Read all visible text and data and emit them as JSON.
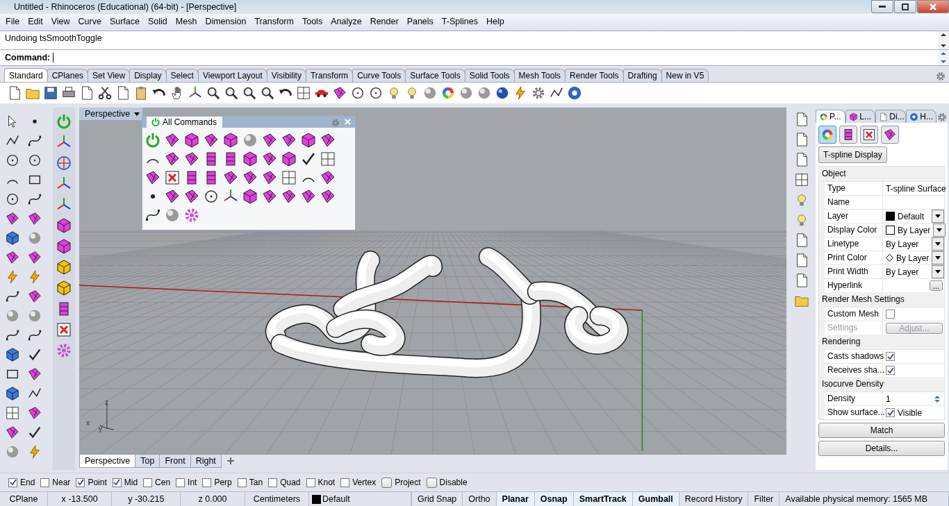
{
  "window": {
    "title": "Untitled - Rhinoceros (Educational) (64-bit) - [Perspective]"
  },
  "menu": [
    "File",
    "Edit",
    "View",
    "Curve",
    "Surface",
    "Solid",
    "Mesh",
    "Dimension",
    "Transform",
    "Tools",
    "Analyze",
    "Render",
    "Panels",
    "T-Splines",
    "Help"
  ],
  "command": {
    "history": "Undoing tsSmoothToggle",
    "prompt": "Command:"
  },
  "toolbar_tabs": [
    {
      "label": "Standard",
      "selected": true
    },
    {
      "label": "CPlanes",
      "selected": false
    },
    {
      "label": "Set View",
      "selected": false
    },
    {
      "label": "Display",
      "selected": false
    },
    {
      "label": "Select",
      "selected": false
    },
    {
      "label": "Viewport Layout",
      "selected": false
    },
    {
      "label": "Visibility",
      "selected": false
    },
    {
      "label": "Transform",
      "selected": false
    },
    {
      "label": "Curve Tools",
      "selected": false
    },
    {
      "label": "Surface Tools",
      "selected": false
    },
    {
      "label": "Solid Tools",
      "selected": false
    },
    {
      "label": "Mesh Tools",
      "selected": false
    },
    {
      "label": "Render Tools",
      "selected": false
    },
    {
      "label": "Drafting",
      "selected": false
    },
    {
      "label": "New in V5",
      "selected": false
    }
  ],
  "viewport": {
    "title": "Perspective",
    "axis_labels": [
      "z",
      "x",
      "y"
    ]
  },
  "viewport_tabs": [
    {
      "label": "Perspective",
      "selected": true
    },
    {
      "label": "Top",
      "selected": false
    },
    {
      "label": "Front",
      "selected": false
    },
    {
      "label": "Right",
      "selected": false
    }
  ],
  "commands_panel": {
    "title": "All Commands"
  },
  "properties": {
    "tabs": [
      {
        "label": "P...",
        "selected": true
      },
      {
        "label": "L...",
        "selected": false
      },
      {
        "label": "Di...",
        "selected": false
      },
      {
        "label": "H...",
        "selected": false
      }
    ],
    "display_button": "T-spline Display",
    "sections": [
      {
        "title": "Object",
        "rows": [
          {
            "kind": "text",
            "label": "Type",
            "value": "T-spline Surface",
            "disabled": false
          },
          {
            "kind": "text",
            "label": "Name",
            "disabled": false
          },
          {
            "kind": "dropdown",
            "label": "Layer",
            "value": "Default",
            "color": "#000000",
            "disabled": false
          },
          {
            "kind": "dropdown",
            "label": "Display Color",
            "value": "By Layer",
            "color": "#ffffff",
            "disabled": false
          },
          {
            "kind": "dropdown",
            "label": "Linetype",
            "value": "By Layer",
            "disabled": false
          },
          {
            "kind": "diamond",
            "label": "Print Color",
            "value": "By Layer",
            "disabled": false
          },
          {
            "kind": "dropdown",
            "label": "Print Width",
            "value": "By Layer",
            "disabled": false
          },
          {
            "kind": "button",
            "label": "Hyperlink",
            "button": "...",
            "disabled": false
          }
        ]
      },
      {
        "title": "Render Mesh Settings",
        "rows": [
          {
            "kind": "checkbox",
            "label": "Custom Mesh",
            "checked": false,
            "disabled": false
          },
          {
            "kind": "wide-button",
            "label": "Settings",
            "button": "Adjust...",
            "disabled": true
          }
        ]
      },
      {
        "title": "Rendering",
        "rows": [
          {
            "kind": "checkbox",
            "label": "Casts shadows",
            "checked": true,
            "disabled": false
          },
          {
            "kind": "checkbox",
            "label": "Receives sha...",
            "checked": true,
            "disabled": false
          }
        ]
      },
      {
        "title": "Isocurve Density",
        "rows": [
          {
            "kind": "spinner",
            "label": "Density",
            "value": "1",
            "disabled": false
          },
          {
            "kind": "checkbox",
            "label": "Show surface...",
            "checked": true,
            "value": "Visible",
            "disabled": false
          }
        ]
      }
    ],
    "buttons": [
      "Match",
      "Details..."
    ]
  },
  "osnaps": [
    {
      "kind": "snap",
      "label": "End",
      "checked": true
    },
    {
      "kind": "snap",
      "label": "Near",
      "checked": false
    },
    {
      "kind": "snap",
      "label": "Point",
      "checked": true
    },
    {
      "kind": "snap",
      "label": "Mid",
      "checked": true
    },
    {
      "kind": "snap",
      "label": "Cen",
      "checked": false
    },
    {
      "kind": "snap",
      "label": "Int",
      "checked": false
    },
    {
      "kind": "snap",
      "label": "Perp",
      "checked": false
    },
    {
      "kind": "snap",
      "label": "Tan",
      "checked": false
    },
    {
      "kind": "snap",
      "label": "Quad",
      "checked": false
    },
    {
      "kind": "snap",
      "label": "Knot",
      "checked": false
    },
    {
      "kind": "snap",
      "label": "Vertex",
      "checked": false
    },
    {
      "kind": "toggle",
      "label": "Project",
      "checked": false
    },
    {
      "kind": "toggle",
      "label": "Disable",
      "checked": false
    }
  ],
  "status_bar": {
    "coords": [
      "CPlane",
      "x -13.500",
      "y -30.215",
      "z 0.000",
      "Centimeters"
    ],
    "layer": {
      "label": "Default",
      "color": "#000000"
    },
    "toggles": [
      {
        "label": "Grid Snap",
        "on": false
      },
      {
        "label": "Ortho",
        "on": false
      },
      {
        "label": "Planar",
        "on": true
      },
      {
        "label": "Osnap",
        "on": true
      },
      {
        "label": "SmartTrack",
        "on": true
      },
      {
        "label": "Gumball",
        "on": true
      },
      {
        "label": "Record History",
        "on": false
      },
      {
        "label": "Filter",
        "on": false
      }
    ],
    "memory": "Available physical memory: 1565 MB"
  }
}
